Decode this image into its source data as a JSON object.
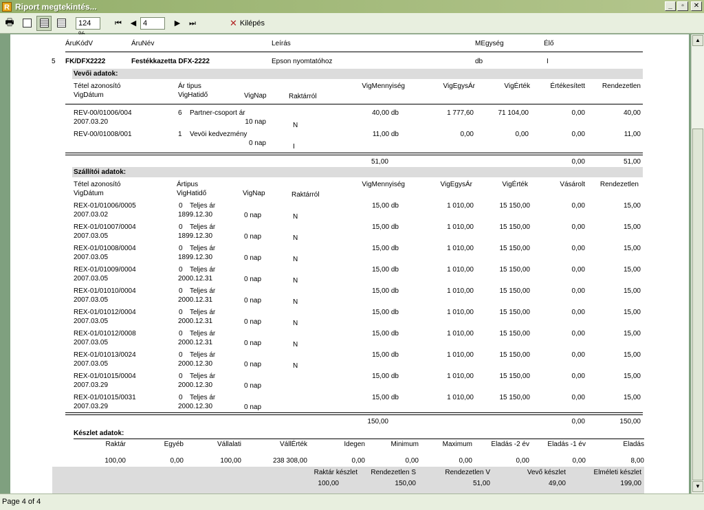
{
  "window": {
    "title": "Riport megtekintés...",
    "app_icon": "R"
  },
  "toolbar": {
    "zoom": "124 %",
    "page": "4",
    "exit_label": "Kilépés"
  },
  "status": {
    "text": "Page 4 of 4"
  },
  "header": {
    "code": "ÁruKódV",
    "name": "ÁruNév",
    "desc": "Leírás",
    "unit": "MEgység",
    "alive": "Élő"
  },
  "product": {
    "index": "5",
    "code": "FK/DFX2222",
    "name": "Festékkazetta DFX-2222",
    "desc": "Epson nyomtatóhoz",
    "unit": "db",
    "alive": "I"
  },
  "buyer": {
    "title": "Vevői adatok:",
    "col_id": "Tétel azonosító",
    "col_date": "VigDátum",
    "col_price_type": "Ár tipus",
    "col_due": "VigHatidő",
    "col_vignap": "VigNap",
    "col_stock": "Raktárról",
    "col_qty": "VigMennyiség",
    "col_unit_price": "VigEgysÁr",
    "col_value": "VigÉrték",
    "col_sold": "Értékesített",
    "col_ordered": "Rendezetlen",
    "rows": [
      {
        "id": "REV-00/01006/004",
        "date": "2007.03.20",
        "ptype_no": "6",
        "ptype": "Partner-csoport ár",
        "due": "",
        "vignap": "10 nap",
        "stock": "N",
        "qty": "40,00 db",
        "unit_price": "1 777,60",
        "value": "71 104,00",
        "sold": "0,00",
        "ordered": "40,00"
      },
      {
        "id": "REV-00/01008/001",
        "date": "",
        "ptype_no": "1",
        "ptype": "Vevöi kedvezmény",
        "due": "",
        "vignap": "0 nap",
        "stock": "I",
        "qty": "11,00 db",
        "unit_price": "0,00",
        "value": "0,00",
        "sold": "0,00",
        "ordered": "11,00"
      }
    ],
    "total_qty": "51,00",
    "total_sold": "0,00",
    "total_ordered": "51,00"
  },
  "supplier": {
    "title": "Szállítói adatok:",
    "col_id": "Tétel azonosító",
    "col_date": "VigDátum",
    "col_price_type": "Ártipus",
    "col_due": "VigHatidő",
    "col_vignap": "VigNap",
    "col_stock": "Raktárról",
    "col_qty": "VigMennyiség",
    "col_unit_price": "VigEgysÁr",
    "col_value": "VigÉrték",
    "col_bought": "Vásárolt",
    "col_ordered": "Rendezetlen",
    "rows": [
      {
        "id": "REX-01/01006/0005",
        "date": "2007.03.02",
        "ptype_no": "0",
        "ptype": "Teljes ár",
        "due": "1899.12.30",
        "vignap": "0 nap",
        "stock": "N",
        "qty": "15,00 db",
        "unit_price": "1 010,00",
        "value": "15 150,00",
        "bought": "0,00",
        "ordered": "15,00"
      },
      {
        "id": "REX-01/01007/0004",
        "date": "2007.03.05",
        "ptype_no": "0",
        "ptype": "Teljes ár",
        "due": "1899.12.30",
        "vignap": "0 nap",
        "stock": "N",
        "qty": "15,00 db",
        "unit_price": "1 010,00",
        "value": "15 150,00",
        "bought": "0,00",
        "ordered": "15,00"
      },
      {
        "id": "REX-01/01008/0004",
        "date": "2007.03.05",
        "ptype_no": "0",
        "ptype": "Teljes ár",
        "due": "1899.12.30",
        "vignap": "0 nap",
        "stock": "N",
        "qty": "15,00 db",
        "unit_price": "1 010,00",
        "value": "15 150,00",
        "bought": "0,00",
        "ordered": "15,00"
      },
      {
        "id": "REX-01/01009/0004",
        "date": "2007.03.05",
        "ptype_no": "0",
        "ptype": "Teljes ár",
        "due": "2000.12.31",
        "vignap": "0 nap",
        "stock": "N",
        "qty": "15,00 db",
        "unit_price": "1 010,00",
        "value": "15 150,00",
        "bought": "0,00",
        "ordered": "15,00"
      },
      {
        "id": "REX-01/01010/0004",
        "date": "2007.03.05",
        "ptype_no": "0",
        "ptype": "Teljes ár",
        "due": "2000.12.31",
        "vignap": "0 nap",
        "stock": "N",
        "qty": "15,00 db",
        "unit_price": "1 010,00",
        "value": "15 150,00",
        "bought": "0,00",
        "ordered": "15,00"
      },
      {
        "id": "REX-01/01012/0004",
        "date": "2007.03.05",
        "ptype_no": "0",
        "ptype": "Teljes ár",
        "due": "2000.12.31",
        "vignap": "0 nap",
        "stock": "N",
        "qty": "15,00 db",
        "unit_price": "1 010,00",
        "value": "15 150,00",
        "bought": "0,00",
        "ordered": "15,00"
      },
      {
        "id": "REX-01/01012/0008",
        "date": "2007.03.05",
        "ptype_no": "0",
        "ptype": "Teljes ár",
        "due": "2000.12.31",
        "vignap": "0 nap",
        "stock": "N",
        "qty": "15,00 db",
        "unit_price": "1 010,00",
        "value": "15 150,00",
        "bought": "0,00",
        "ordered": "15,00"
      },
      {
        "id": "REX-01/01013/0024",
        "date": "2007.03.05",
        "ptype_no": "0",
        "ptype": "Teljes ár",
        "due": "2000.12.30",
        "vignap": "0 nap",
        "stock": "N",
        "qty": "15,00 db",
        "unit_price": "1 010,00",
        "value": "15 150,00",
        "bought": "0,00",
        "ordered": "15,00"
      },
      {
        "id": "REX-01/01015/0004",
        "date": "2007.03.29",
        "ptype_no": "0",
        "ptype": "Teljes ár",
        "due": "2000.12.30",
        "vignap": "0 nap",
        "stock": "",
        "qty": "15,00 db",
        "unit_price": "1 010,00",
        "value": "15 150,00",
        "bought": "0,00",
        "ordered": "15,00"
      },
      {
        "id": "REX-01/01015/0031",
        "date": "2007.03.29",
        "ptype_no": "0",
        "ptype": "Teljes ár",
        "due": "2000.12.30",
        "vignap": "0 nap",
        "stock": "",
        "qty": "15,00 db",
        "unit_price": "1 010,00",
        "value": "15 150,00",
        "bought": "0,00",
        "ordered": "15,00"
      }
    ],
    "total_qty": "150,00",
    "total_bought": "0,00",
    "total_ordered": "150,00"
  },
  "stock": {
    "title": "Készlet adatok:",
    "headers": [
      "Raktár",
      "Egyéb",
      "Vállalati",
      "VállÉrték",
      "Idegen",
      "Minimum",
      "Maximum",
      "Eladás -2 év",
      "Eladás -1 év",
      "Eladás"
    ],
    "values": [
      "100,00",
      "0,00",
      "100,00",
      "238 308,00",
      "0,00",
      "0,00",
      "0,00",
      "0,00",
      "0,00",
      "8,00"
    ]
  },
  "summary": {
    "headers": [
      "Raktár készlet",
      "Rendezetlen S",
      "Rendezetlen V",
      "Vevő készlet",
      "Elméleti készlet"
    ],
    "values": [
      "100,00",
      "150,00",
      "51,00",
      "49,00",
      "199,00"
    ]
  }
}
